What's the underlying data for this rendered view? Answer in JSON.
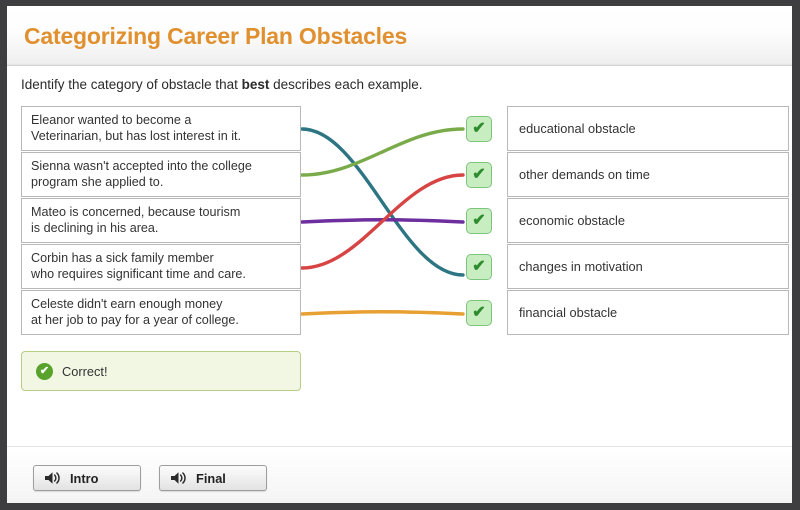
{
  "header": {
    "title": "Categorizing Career Plan Obstacles",
    "title_color": "#e0902f"
  },
  "instruction": {
    "before": "Identify the category of obstacle that ",
    "emphasis": "best",
    "after": " describes each example."
  },
  "prompts": [
    {
      "line1": "Eleanor wanted to become a",
      "line2": "Veterinarian, but has lost interest in it."
    },
    {
      "line1": "Sienna wasn't accepted into the college",
      "line2": "program she applied to."
    },
    {
      "line1": "Mateo is concerned, because tourism",
      "line2": "is declining in his area."
    },
    {
      "line1": "Corbin has a sick family member",
      "line2": "who requires significant time and care."
    },
    {
      "line1": "Celeste didn't earn enough money",
      "line2": "at her job to pay for a year of college."
    }
  ],
  "answers": [
    {
      "label": "educational obstacle",
      "check": "✔"
    },
    {
      "label": "other demands on time",
      "check": "✔"
    },
    {
      "label": "economic obstacle",
      "check": "✔"
    },
    {
      "label": "changes in motivation",
      "check": "✔"
    },
    {
      "label": "financial obstacle",
      "check": "✔"
    }
  ],
  "connections": [
    {
      "from_prompt": 1,
      "to_answer": 4,
      "color": "#2d7583"
    },
    {
      "from_prompt": 2,
      "to_answer": 1,
      "color": "#7aab4b"
    },
    {
      "from_prompt": 3,
      "to_answer": 3,
      "color": "#6d2e9e"
    },
    {
      "from_prompt": 4,
      "to_answer": 2,
      "color": "#d64444"
    },
    {
      "from_prompt": 5,
      "to_answer": 5,
      "color": "#e8a032"
    }
  ],
  "feedback": {
    "text": "Correct!",
    "icon": "✔",
    "background": "#f2f7e4",
    "border": "#b6cf84",
    "icon_color": "#59a32d"
  },
  "footer": {
    "buttons": [
      {
        "label": "Intro",
        "icon": "speaker-icon"
      },
      {
        "label": "Final",
        "icon": "speaker-icon"
      }
    ]
  }
}
